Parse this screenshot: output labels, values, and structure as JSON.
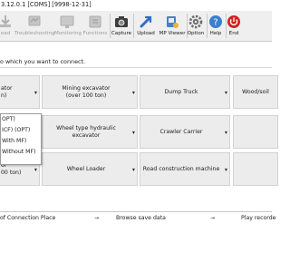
{
  "window": {
    "title": "3.12.0.1 [COMS] [9998-12-31]"
  },
  "toolbar": {
    "items": [
      {
        "label": "oad",
        "icon": "download-icon",
        "enabled": false
      },
      {
        "label": "Troubleshooting",
        "icon": "troubleshooting-icon",
        "enabled": false
      },
      {
        "label": "Monitoring",
        "icon": "monitoring-icon",
        "enabled": false
      },
      {
        "label": "Functions",
        "icon": "functions-icon",
        "enabled": false
      },
      {
        "label": "Capture",
        "icon": "camera-icon",
        "enabled": true
      },
      {
        "label": "Upload",
        "icon": "upload-icon",
        "enabled": true
      },
      {
        "label": "MP Viewer",
        "icon": "mp-viewer-icon",
        "enabled": true
      },
      {
        "label": "Option",
        "icon": "option-gear-icon",
        "enabled": true
      },
      {
        "label": "Help",
        "icon": "help-icon",
        "enabled": true
      },
      {
        "label": "End",
        "icon": "power-icon",
        "enabled": true
      }
    ]
  },
  "instruction": "o which you want to connect.",
  "tiles": {
    "r1c1": {
      "line1": "ator",
      "line2": "n)"
    },
    "r1c2": {
      "line1": "Mining excavator",
      "line2": "(over 100 ton)"
    },
    "r1c3": {
      "line1": "Dump Truck"
    },
    "r1c4": {
      "line1": "Wood/soil"
    },
    "r2c2": {
      "line1": "Wheel type hydraulic excavator"
    },
    "r2c3": {
      "line1": "Crawler Carrier"
    },
    "r3c1": {
      "line1": "or",
      "line2": "00 ton)"
    },
    "r3c2": {
      "line1": "Wheel Loader"
    },
    "r3c3": {
      "line1": "Road construction machine"
    }
  },
  "popup": {
    "options": [
      "OPT)",
      "ICF) (OPT)",
      "With MF)",
      "Without MF)"
    ]
  },
  "bottom": {
    "links": [
      "of Connection Place",
      "Browse save data",
      "Play recorde"
    ]
  },
  "colors": {
    "toolbar_bg": "#efefef",
    "tile_bg": "#ececec",
    "end_red": "#d42020",
    "help_blue": "#3a7fd0"
  }
}
